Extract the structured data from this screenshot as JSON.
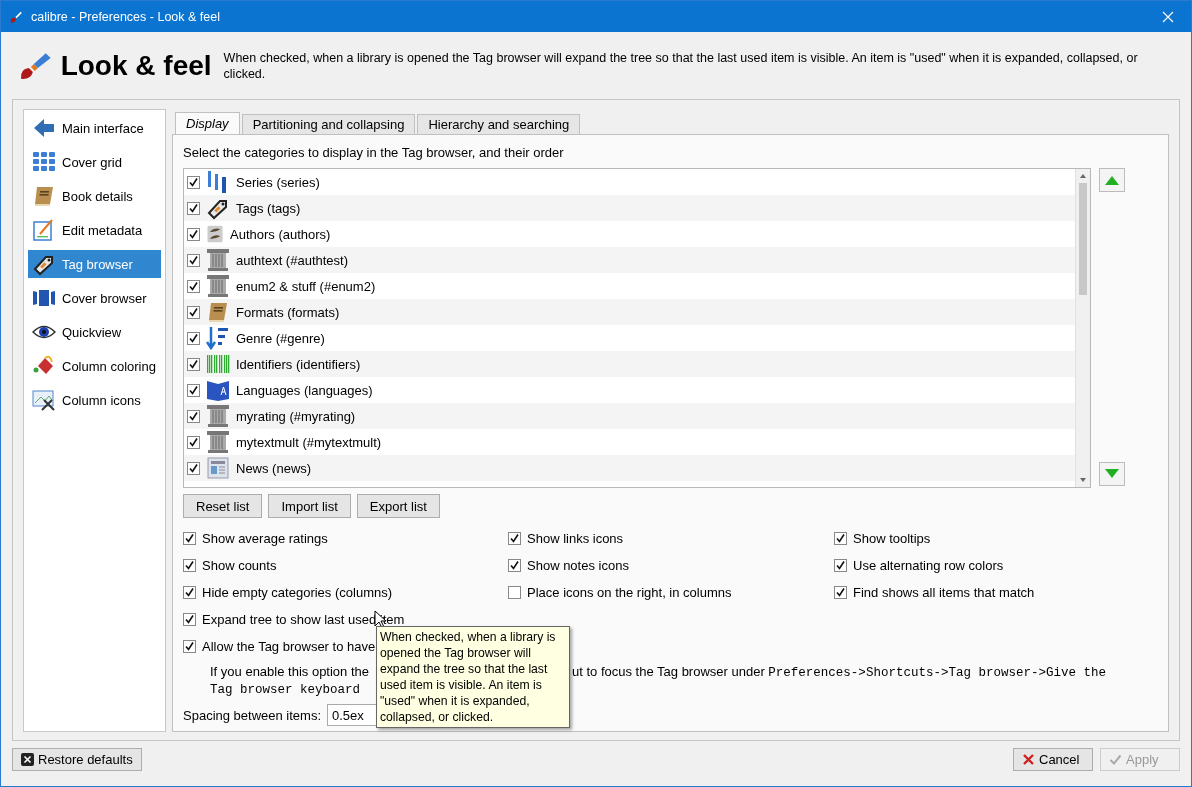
{
  "window": {
    "title": "calibre - Preferences - Look & feel"
  },
  "header": {
    "title": "Look & feel",
    "description": "When checked, when a library is opened the Tag browser will expand the tree so that the last used item is visible. An item is \"used\" when it is expanded, collapsed, or clicked."
  },
  "sidebar": {
    "items": [
      {
        "label": "Main interface",
        "kind": "arrow",
        "selected": false
      },
      {
        "label": "Cover grid",
        "kind": "grid",
        "selected": false
      },
      {
        "label": "Book details",
        "kind": "book",
        "selected": false
      },
      {
        "label": "Edit metadata",
        "kind": "edit",
        "selected": false
      },
      {
        "label": "Tag browser",
        "kind": "tag",
        "selected": true
      },
      {
        "label": "Cover browser",
        "kind": "coverflow",
        "selected": false
      },
      {
        "label": "Quickview",
        "kind": "eye",
        "selected": false
      },
      {
        "label": "Column coloring",
        "kind": "coloring",
        "selected": false
      },
      {
        "label": "Column icons",
        "kind": "images",
        "selected": false
      }
    ]
  },
  "tabs": [
    {
      "label": "Display",
      "selected": true
    },
    {
      "label": "Partitioning and collapsing",
      "selected": false
    },
    {
      "label": "Hierarchy and searching",
      "selected": false
    }
  ],
  "categories": {
    "label": "Select the categories to display in the Tag browser, and their order",
    "items": [
      {
        "label": "Series (series)",
        "kind": "series",
        "checked": true
      },
      {
        "label": "Tags (tags)",
        "kind": "tag",
        "checked": true
      },
      {
        "label": "Authors (authors)",
        "kind": "authors",
        "checked": true
      },
      {
        "label": "authtext (#authtest)",
        "kind": "column",
        "checked": true
      },
      {
        "label": "enum2 & stuff (#enum2)",
        "kind": "column",
        "checked": true
      },
      {
        "label": "Formats (formats)",
        "kind": "book",
        "checked": true
      },
      {
        "label": "Genre (#genre)",
        "kind": "genre",
        "checked": true
      },
      {
        "label": "Identifiers (identifiers)",
        "kind": "barcode",
        "checked": true
      },
      {
        "label": "Languages (languages)",
        "kind": "languages",
        "checked": true
      },
      {
        "label": "myrating (#myrating)",
        "kind": "column",
        "checked": true
      },
      {
        "label": "mytextmult (#mytextmult)",
        "kind": "column",
        "checked": true
      },
      {
        "label": "News (news)",
        "kind": "news",
        "checked": true
      }
    ]
  },
  "list_buttons": [
    "Reset list",
    "Import list",
    "Export list"
  ],
  "option_rows": [
    [
      {
        "label": "Show average ratings",
        "checked": true
      },
      {
        "label": "Show links icons",
        "checked": true
      },
      {
        "label": "Show tooltips",
        "checked": true
      }
    ],
    [
      {
        "label": "Show counts",
        "checked": true
      },
      {
        "label": "Show notes icons",
        "checked": true
      },
      {
        "label": "Use alternating row colors",
        "checked": true
      }
    ],
    [
      {
        "label": "Hide empty categories (columns)",
        "checked": true
      },
      {
        "label": "Place icons on the right, in columns",
        "checked": false
      },
      {
        "label": "Find shows all items that match",
        "checked": true
      }
    ],
    [
      {
        "label": "Expand tree to show last used item",
        "checked": true
      }
    ],
    [
      {
        "label": "Allow the Tag browser to have",
        "checked": true
      }
    ]
  ],
  "note": {
    "before": "If you enable this option the",
    "after": "ut to focus the Tag browser under",
    "path": "Preferences->Shortcuts->Tag browser->Give the",
    "line2": "Tag browser keyboard"
  },
  "spacing": {
    "label": "Spacing between items:",
    "value": "0.5ex"
  },
  "tooltip": {
    "text": "When checked, when a library is opened the Tag browser will expand the tree so that the last used item is visible. An item is \"used\" when it is expanded, collapsed, or clicked."
  },
  "footer": {
    "restore": "Restore defaults",
    "cancel": "Cancel",
    "apply": {
      "label": "Apply",
      "disabled": true
    }
  }
}
